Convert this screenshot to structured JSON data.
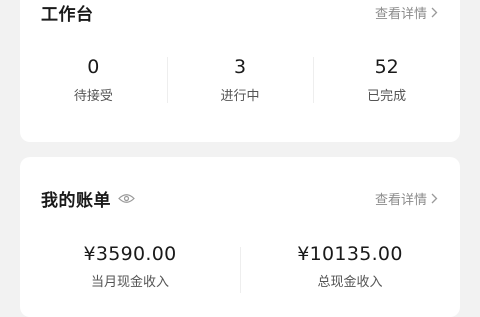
{
  "workbench": {
    "title": "工作台",
    "detail_label": "查看详情",
    "stats": [
      {
        "value": "0",
        "label": "待接受"
      },
      {
        "value": "3",
        "label": "进行中"
      },
      {
        "value": "52",
        "label": "已完成"
      }
    ]
  },
  "bill": {
    "title": "我的账单",
    "detail_label": "查看详情",
    "incomes": [
      {
        "value": "¥3590.00",
        "label": "当月现金收入"
      },
      {
        "value": "¥10135.00",
        "label": "总现金收入"
      }
    ]
  },
  "icons": {
    "visibility": "eye-icon",
    "more": "chevron-right-icon"
  },
  "colors": {
    "background": "#f2f2f2",
    "card": "#ffffff",
    "muted_text": "#8c8c8c"
  }
}
